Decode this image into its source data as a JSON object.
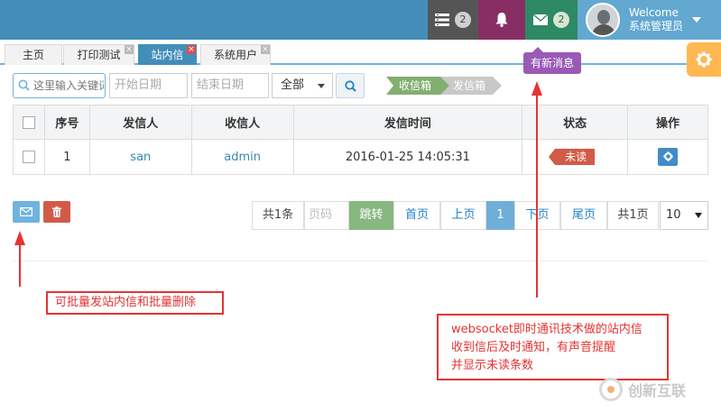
{
  "topbar": {
    "tasks_count": "2",
    "mail_count": "2",
    "welcome": "Welcome",
    "username": "系统管理员"
  },
  "tabs": [
    {
      "label": "主页"
    },
    {
      "label": "打印测试"
    },
    {
      "label": "站内信"
    },
    {
      "label": "系统用户"
    }
  ],
  "tooltip": "有新消息",
  "search": {
    "placeholder": "这里输入关键词",
    "start_date_placeholder": "开始日期",
    "end_date_placeholder": "结束日期",
    "filter_value": "全部"
  },
  "breadcrumb": {
    "inbox": "收信箱",
    "outbox": "发信箱"
  },
  "table": {
    "headers": [
      "",
      "序号",
      "发信人",
      "收信人",
      "发信时间",
      "状态",
      "操作"
    ],
    "rows": [
      {
        "index": "1",
        "sender": "san",
        "receiver": "admin",
        "time": "2016-01-25 14:05:31",
        "status": "未读"
      }
    ]
  },
  "pagination": {
    "total": "共1条",
    "page_placeholder": "页码",
    "jump": "跳转",
    "first": "首页",
    "prev": "上页",
    "current": "1",
    "next": "下页",
    "last": "尾页",
    "pages": "共1页",
    "page_size": "10"
  },
  "annotations": {
    "batch": "可批量发站内信和批量删除",
    "ws_line1": "websocket即时通讯技术做的站内信",
    "ws_line2": "收到信后及时通知，有声音提醒",
    "ws_line3": "并显示未读条数"
  },
  "watermark": "创新互联",
  "colors": {
    "topbar": "#438eb9",
    "bell_bg": "#892e65",
    "mail_bg": "#2e8965",
    "tooltip": "#9b59b6",
    "annotation": "#e53333"
  }
}
